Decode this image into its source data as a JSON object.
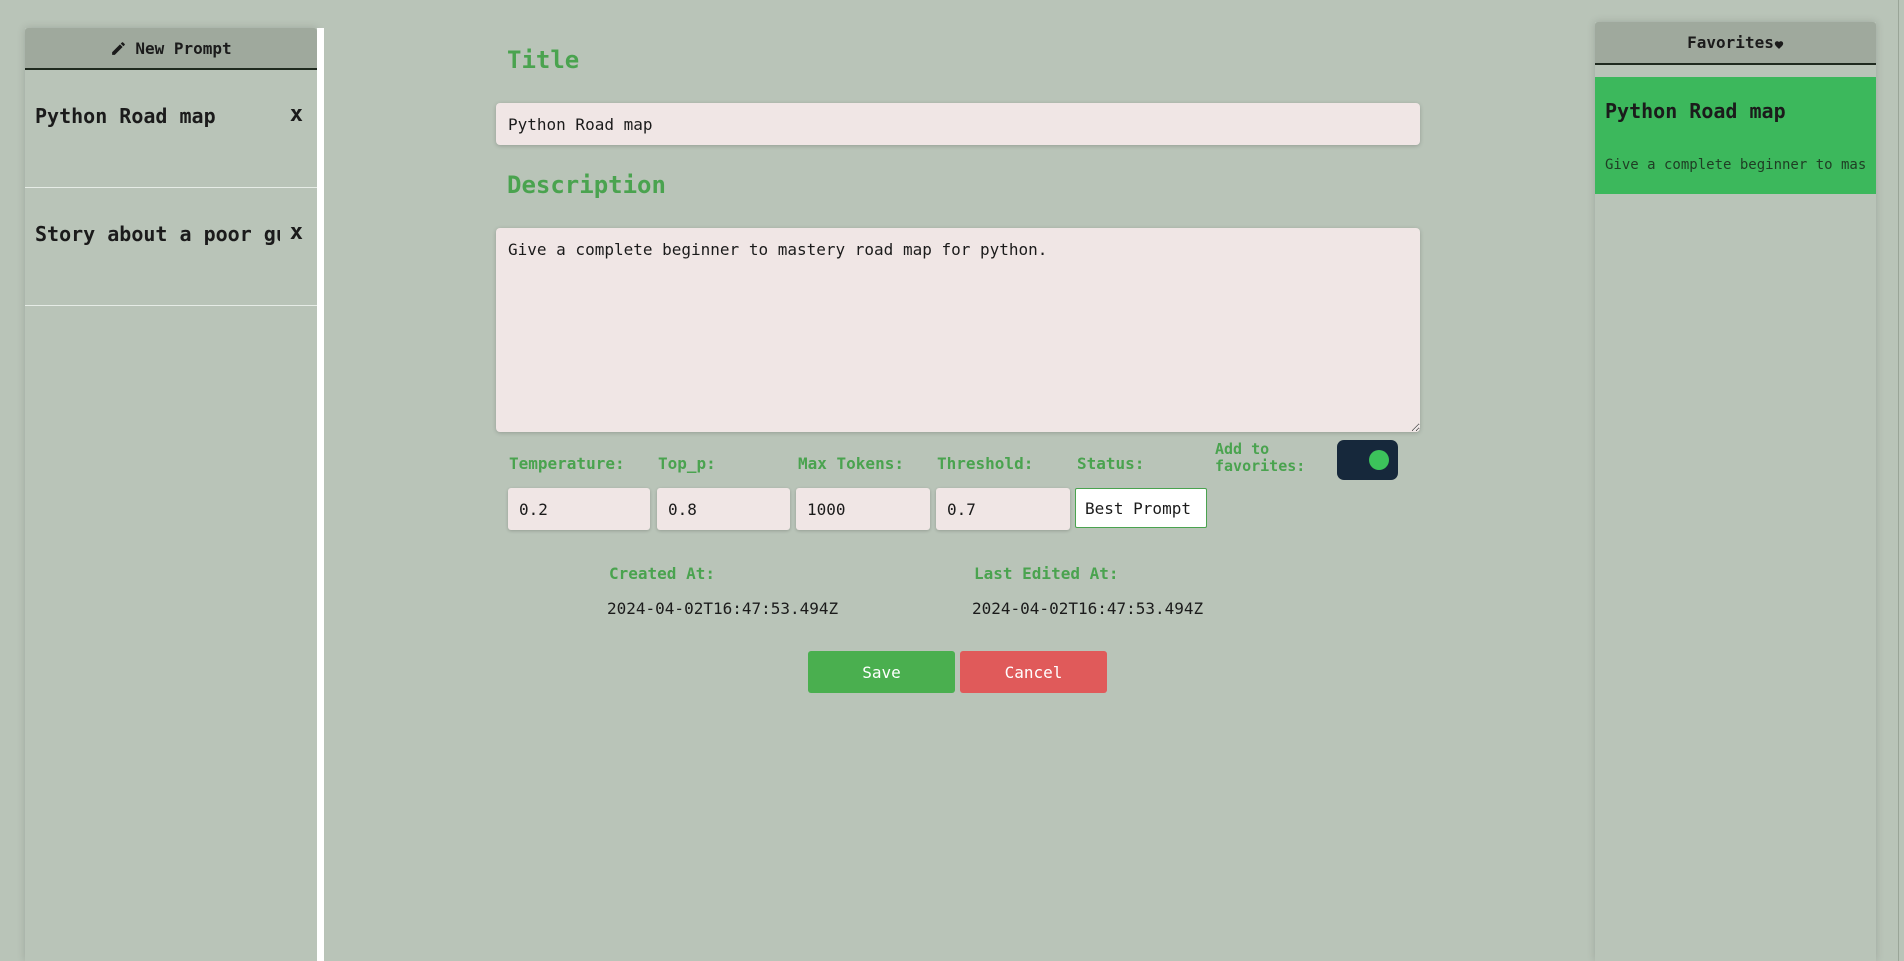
{
  "sidebar": {
    "new_prompt_label": "New Prompt",
    "new_prompt_icon": "pencil-icon",
    "items": [
      {
        "title": "Python Road map",
        "close": "x"
      },
      {
        "title": "Story about a poor guy",
        "close": "x"
      }
    ]
  },
  "editor": {
    "title_label": "Title",
    "title_value": "Python Road map",
    "description_label": "Description",
    "description_value": "Give a complete beginner to mastery road map for python.",
    "params": {
      "temperature_label": "Temperature:",
      "temperature_value": "0.2",
      "top_p_label": "Top_p:",
      "top_p_value": "0.8",
      "max_tokens_label": "Max Tokens:",
      "max_tokens_value": "1000",
      "threshold_label": "Threshold:",
      "threshold_value": "0.7",
      "status_label": "Status:",
      "status_value": "Best Prompt",
      "favorites_label": "Add to favorites:",
      "favorites_on": true
    },
    "created_at_label": "Created At:",
    "created_at_value": "2024-04-02T16:47:53.494Z",
    "last_edited_label": "Last Edited At:",
    "last_edited_value": "2024-04-02T16:47:53.494Z",
    "save_label": "Save",
    "cancel_label": "Cancel"
  },
  "favorites": {
    "header": "Favorites",
    "header_icon": "heart-icon",
    "items": [
      {
        "title": "Python Road map",
        "description": "Give a complete beginner to mastery road map for python."
      }
    ]
  },
  "colors": {
    "background": "#b9c4b8",
    "accent_green": "#4aa34f",
    "save": "#4aaf4f",
    "cancel": "#e05a5a",
    "favorite_card": "#3cb85c",
    "toggle_track": "#16283b"
  }
}
